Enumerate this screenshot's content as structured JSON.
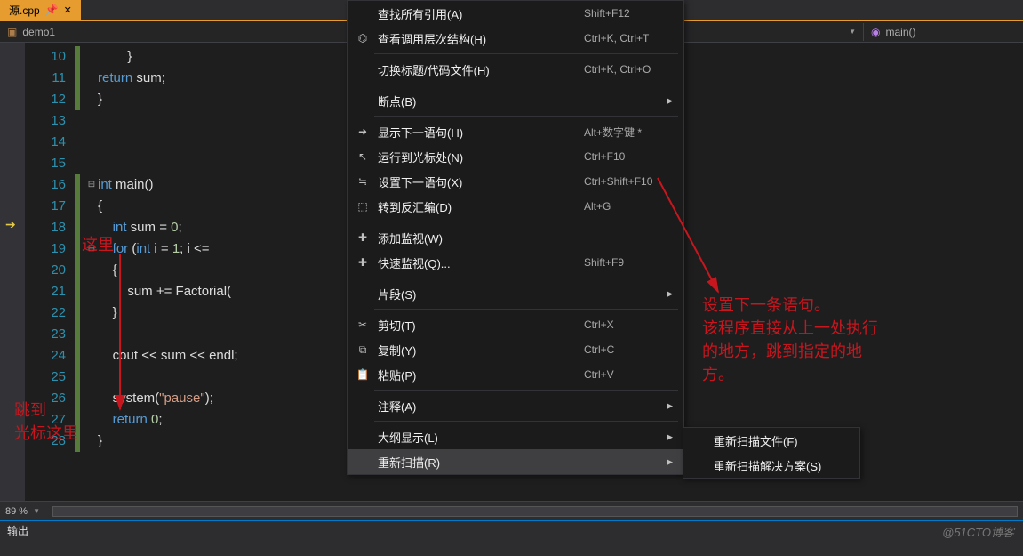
{
  "tab": {
    "title": "源.cpp",
    "close": "✕"
  },
  "nav": {
    "left": "demo1",
    "right": "main()"
  },
  "gutter": {
    "start": 10,
    "end": 28,
    "breakpoint_line": 18
  },
  "code": {
    "lines": [
      {
        "cb": "green",
        "fold": "",
        "txt": "        }"
      },
      {
        "cb": "green",
        "fold": "",
        "kw": "return",
        "rest": " sum;"
      },
      {
        "cb": "green",
        "fold": "",
        "txt": "}"
      },
      {
        "cb": "none",
        "fold": "",
        "txt": ""
      },
      {
        "cb": "none",
        "fold": "",
        "txt": ""
      },
      {
        "cb": "none",
        "fold": "",
        "txt": ""
      },
      {
        "cb": "green",
        "fold": "⊟",
        "kw": "int",
        "rest": " main()"
      },
      {
        "cb": "green",
        "fold": "",
        "txt": "{"
      },
      {
        "cb": "green",
        "fold": "",
        "pre": "    ",
        "kw": "int",
        "rest2": " sum = ",
        "num": "0",
        "tail": ";"
      },
      {
        "cb": "green",
        "fold": "⊟",
        "pre": "    ",
        "kw": "for",
        "rest2": " (",
        "kw2": "int",
        "rest3": " i = ",
        "num": "1",
        "tail": "; i <= "
      },
      {
        "cb": "green",
        "fold": "",
        "txt": "    {"
      },
      {
        "cb": "green",
        "fold": "",
        "txt": "        sum += Factorial("
      },
      {
        "cb": "green",
        "fold": "",
        "txt": "    }"
      },
      {
        "cb": "green",
        "fold": "",
        "txt": ""
      },
      {
        "cb": "green",
        "fold": "",
        "txt": "    cout << sum << endl;"
      },
      {
        "cb": "green",
        "fold": "",
        "txt": ""
      },
      {
        "cb": "green",
        "fold": "",
        "pre": "    system(",
        "str": "\"pause\"",
        "tail": ");"
      },
      {
        "cb": "green",
        "fold": "",
        "pre": "    ",
        "kw": "return",
        "rest2": " ",
        "num": "0",
        "tail": ";"
      },
      {
        "cb": "green",
        "fold": "",
        "txt": "}"
      }
    ]
  },
  "menu": {
    "items": [
      {
        "icon": "",
        "label": "查找所有引用(A)",
        "short": "Shift+F12"
      },
      {
        "icon": "⌬",
        "label": "查看调用层次结构(H)",
        "short": "Ctrl+K, Ctrl+T"
      },
      {
        "sep": true
      },
      {
        "icon": "",
        "label": "切换标题/代码文件(H)",
        "short": "Ctrl+K, Ctrl+O"
      },
      {
        "sep": true
      },
      {
        "icon": "",
        "label": "断点(B)",
        "sub": true
      },
      {
        "sep": true
      },
      {
        "icon": "➜",
        "label": "显示下一语句(H)",
        "short": "Alt+数字键 *"
      },
      {
        "icon": "↖",
        "label": "运行到光标处(N)",
        "short": "Ctrl+F10"
      },
      {
        "icon": "≒",
        "label": "设置下一语句(X)",
        "short": "Ctrl+Shift+F10"
      },
      {
        "icon": "⬚",
        "label": "转到反汇编(D)",
        "short": "Alt+G"
      },
      {
        "sep": true
      },
      {
        "icon": "✚",
        "label": "添加监视(W)",
        "short": ""
      },
      {
        "icon": "✚",
        "label": "快速监视(Q)...",
        "short": "Shift+F9"
      },
      {
        "sep": true
      },
      {
        "icon": "",
        "label": "片段(S)",
        "sub": true
      },
      {
        "sep": true
      },
      {
        "icon": "✂",
        "label": "剪切(T)",
        "short": "Ctrl+X"
      },
      {
        "icon": "⧉",
        "label": "复制(Y)",
        "short": "Ctrl+C"
      },
      {
        "icon": "📋",
        "label": "粘贴(P)",
        "short": "Ctrl+V"
      },
      {
        "sep": true
      },
      {
        "icon": "",
        "label": "注释(A)",
        "sub": true
      },
      {
        "sep": true
      },
      {
        "icon": "",
        "label": "大纲显示(L)",
        "sub": true
      },
      {
        "icon": "",
        "label": "重新扫描(R)",
        "sub": true,
        "hl": true
      }
    ]
  },
  "submenu": {
    "items": [
      {
        "label": "重新扫描文件(F)"
      },
      {
        "label": "重新扫描解决方案(S)"
      }
    ]
  },
  "annotations": {
    "a1": "这里",
    "a2_l1": "跳到",
    "a2_l2": "光标这里",
    "a3_l1": "设置下一条语句。",
    "a3_l2": "该程序直接从上一处执行",
    "a3_l3": "的地方，跳到指定的地",
    "a3_l4": "方。"
  },
  "zoom": "89 %",
  "output": "输出",
  "watermark": "@51CTO博客"
}
